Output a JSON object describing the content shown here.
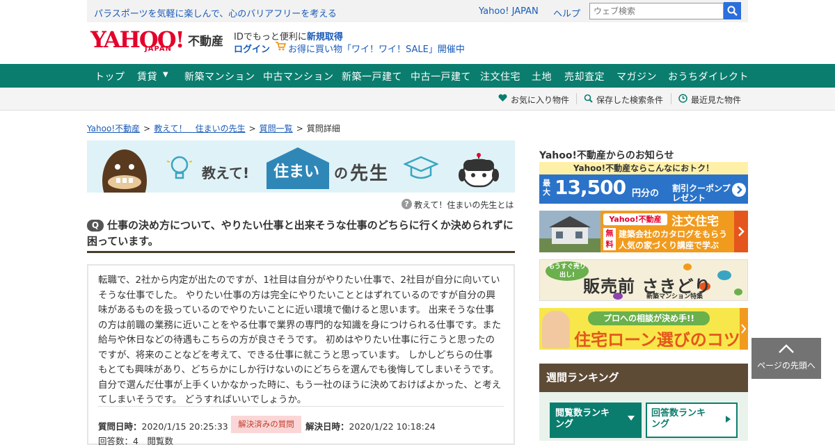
{
  "top_strip": {
    "tagline": "パラスポーツを気軽に楽しんで、心のバリアフリーを考える",
    "yahoo_japan": "Yahoo! JAPAN",
    "help": "ヘルプ",
    "search_placeholder": "ウェブ検索"
  },
  "header": {
    "logo_yahoo": "YAHOO!",
    "logo_japan": "JAPAN",
    "logo_fudosan": "不動産",
    "id_prefix": "IDでもっと便利に",
    "id_link": "新規取得",
    "login": "ログイン",
    "sale": "お得に買い物「ワイ！ワイ！SALE」開催中"
  },
  "nav": {
    "items": [
      "トップ",
      "賃貸",
      "新築マンション",
      "中古マンション",
      "新築一戸建て",
      "中古一戸建て",
      "注文住宅",
      "土地",
      "売却査定",
      "マガジン",
      "おうちダイレクト"
    ],
    "dropdown_arrow": "▼"
  },
  "subnav": {
    "favorites": "お気に入り物件",
    "saved_search": "保存した検索条件",
    "recent": "最近見た物件"
  },
  "breadcrumb": {
    "home": "Yahoo!不動産",
    "section": "教えて！　住まいの先生",
    "list": "質問一覧",
    "current": "質問詳細",
    "sep": ">"
  },
  "banner": {
    "oshiete": "教えて!",
    "sumai": "住まい",
    "no": "の",
    "sensei": "先生"
  },
  "about": {
    "icon": "?",
    "label": "教えて！住まいの先生とは"
  },
  "question": {
    "badge": "Q",
    "title": "仕事の決め方について、やりたい仕事と出来そうな仕事のどちらに行くか決められずに困っています。",
    "body": "転職で、2社から内定が出たのですが、1社目は自分がやりたい仕事で、2社目が自分に向いていそうな仕事でした。 やりたい仕事の方は完全にやりたいこととはずれているのですが自分の興味があるものを扱っているのでやりたいことに近い環境で働けると思います。 出来そうな仕事の方は前職の業務に近いことをやる仕事で業界の専門的な知識を身につけられる仕事です。また給与や休日などの待遇もこちらの方が良さそうです。 初めはやりたい仕事に行こうと思ったのですが、将来のことなどを考えて、できる仕事に就こうと思っています。 しかしどちらの仕事もとても興味があり、どちらかにしか行けないのにどちらを選んでも後悔してしまいそうです。 自分で選んだ仕事が上手くいかなかった時に、もう一社のほうに決めておけばよかった、と考えてしまいそうです。 どうすればいいでしょうか。",
    "asked_label": "質問日時：",
    "asked": "2020/1/15 20:25:33",
    "status": "解決済みの質問",
    "resolved_label": "解決日時：",
    "resolved": "2020/1/22 10:18:24",
    "stats_partial": "回答数：4　閲覧数"
  },
  "sidebar": {
    "news_title": "Yahoo!不動産からのお知らせ",
    "ad1": {
      "top": "Yahoo!不動産ならこんなにおトク！",
      "saidai": "最大",
      "amount": "13,500",
      "yen": "円分の",
      "coupon": "割引クーポンプレゼント"
    },
    "ad2": {
      "brand": "Yahoo!不動産",
      "head": "注文住宅",
      "free": "無料",
      "line1": "建築会社のカタログをもらう",
      "line2": "人気の家づくり講座で学ぶ"
    },
    "ad3": {
      "bubble": "もうすぐ売り出し!",
      "main": "販売前 さきどり",
      "sub": "新築マンション特集"
    },
    "ad4": {
      "bubble": "プロへの相談が決め手!!",
      "main": "住宅ローン選びのコツ"
    },
    "ranking": {
      "title": "週間ランキング",
      "tab1": "閲覧数ランキング",
      "tab2": "回答数ランキング"
    }
  },
  "to_top": "ページの先頭へ",
  "colors": {
    "nav_green": "#0b7d6e",
    "link_blue": "#1a5bb8",
    "yahoo_red": "#e4002b",
    "rank_brown": "#5e4b36"
  }
}
